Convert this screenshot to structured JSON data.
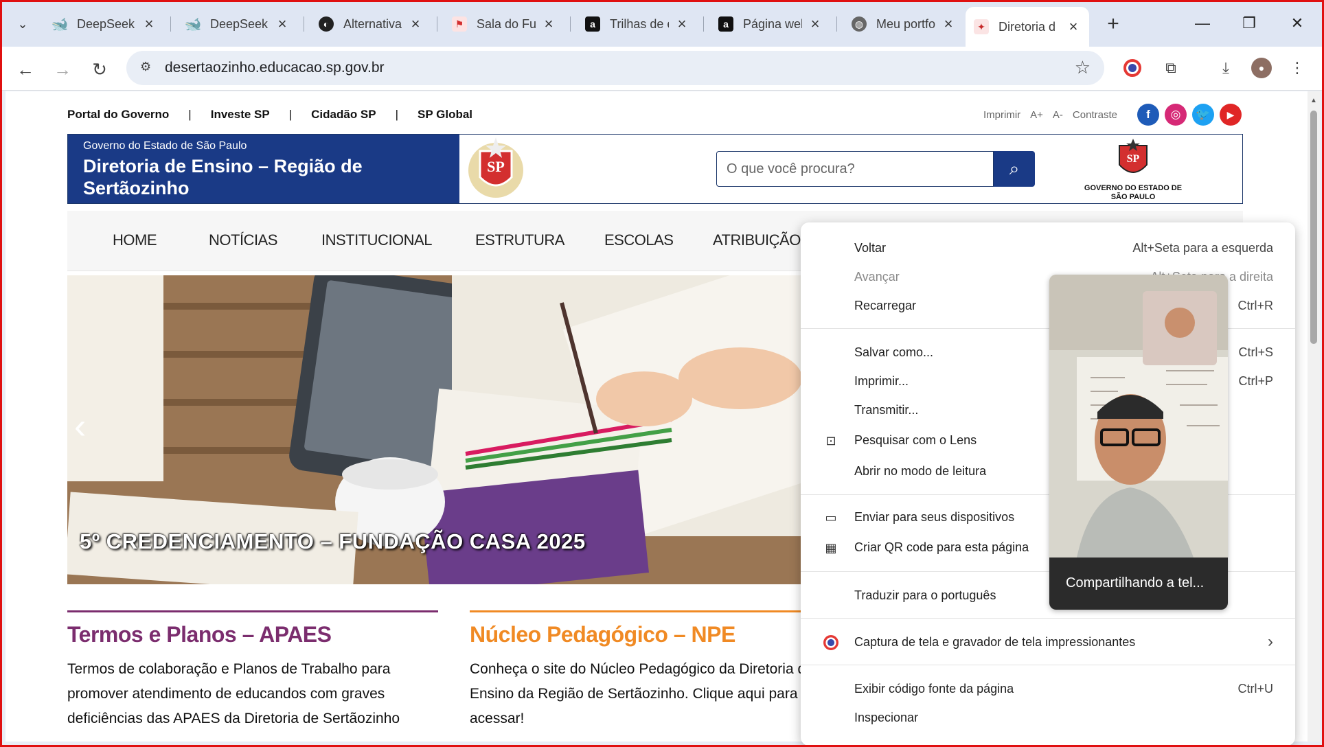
{
  "tabs": [
    {
      "title": "DeepSeek |",
      "icon": "deepseek-icon",
      "color": "#4d6bfe"
    },
    {
      "title": "DeepSeek -",
      "icon": "deepseek-icon",
      "color": "#4d6bfe"
    },
    {
      "title": "Alternativa",
      "icon": "circle-logo-icon",
      "color": "#222222"
    },
    {
      "title": "Sala do Fut",
      "icon": "sala-icon",
      "color": "#d32f2f"
    },
    {
      "title": "Trilhas de e",
      "icon": "a-letter-icon",
      "color": "#111111"
    },
    {
      "title": "Página wel",
      "icon": "a-letter-icon",
      "color": "#111111"
    },
    {
      "title": "Meu portfo",
      "icon": "globe-icon",
      "color": "#555555"
    },
    {
      "title": "Diretoria d",
      "icon": "sp-seal-icon",
      "color": "#c62828",
      "active": true
    }
  ],
  "toolbar": {
    "url": "desertaozinho.educacao.sp.gov.br"
  },
  "site": {
    "topbar": {
      "portal": "Portal do Governo",
      "sep": "|",
      "investe": "Investe SP",
      "cidadao": "Cidadão SP",
      "global": "SP Global"
    },
    "tools": {
      "print": "Imprimir",
      "font_up": "A+",
      "font_down": "A-",
      "contrast": "Contraste"
    },
    "banner": {
      "gov": "Governo do Estado de São Paulo",
      "title": "Diretoria de Ensino – Região de Sertãozinho",
      "search_placeholder": "O que você procura?",
      "gov_logo_text": "GOVERNO DO ESTADO DE SÃO PAULO",
      "seal_text": "SP"
    },
    "nav": [
      "HOME",
      "NOTÍCIAS",
      "INSTITUCIONAL",
      "ESTRUTURA",
      "ESCOLAS",
      "ATRIBUIÇÃO"
    ],
    "hero": {
      "caption": "5º CREDENCIAMENTO – FUNDAÇÃO CASA 2025",
      "prev": "‹"
    },
    "cards": [
      {
        "title": "Termos e Planos – APAES",
        "text": "Termos de colaboração e Planos de Trabalho para promover atendimento de educandos com graves deficiências das APAES da Diretoria de Sertãozinho",
        "color": "#7b2d6e"
      },
      {
        "title": "Núcleo Pedagógico – NPE",
        "text": "Conheça o site do Núcleo Pedagógico da Diretoria de Ensino da Região de Sertãozinho. Clique aqui para acessar!",
        "color": "#f08a24"
      }
    ]
  },
  "context_menu": {
    "items": [
      {
        "label": "Voltar",
        "shortcut": "Alt+Seta para a esquerda"
      },
      {
        "label": "Avançar",
        "shortcut": "Alt+Seta para a direita",
        "disabled": true
      },
      {
        "label": "Recarregar",
        "shortcut": "Ctrl+R"
      },
      {
        "label": "Salvar como...",
        "shortcut": "Ctrl+S"
      },
      {
        "label": "Imprimir...",
        "shortcut": "Ctrl+P"
      },
      {
        "label": "Transmitir...",
        "shortcut": ""
      },
      {
        "label": "Pesquisar com o Lens",
        "shortcut": "",
        "icon": "lens-icon"
      },
      {
        "label": "Abrir no modo de leitura",
        "shortcut": ""
      },
      {
        "label": "Enviar para seus dispositivos",
        "shortcut": "",
        "icon": "devices-icon"
      },
      {
        "label": "Criar QR code para esta página",
        "shortcut": "",
        "icon": "qr-code-icon"
      },
      {
        "label": "Traduzir para o português",
        "shortcut": ""
      },
      {
        "label": "Captura de tela e gravador de tela impressionantes",
        "shortcut": "›",
        "icon": "screen-capture-extension-icon"
      },
      {
        "label": "Exibir código fonte da página",
        "shortcut": "Ctrl+U"
      },
      {
        "label": "Inspecionar",
        "shortcut": ""
      }
    ]
  },
  "pip": {
    "status": "Compartilhando a tel..."
  }
}
